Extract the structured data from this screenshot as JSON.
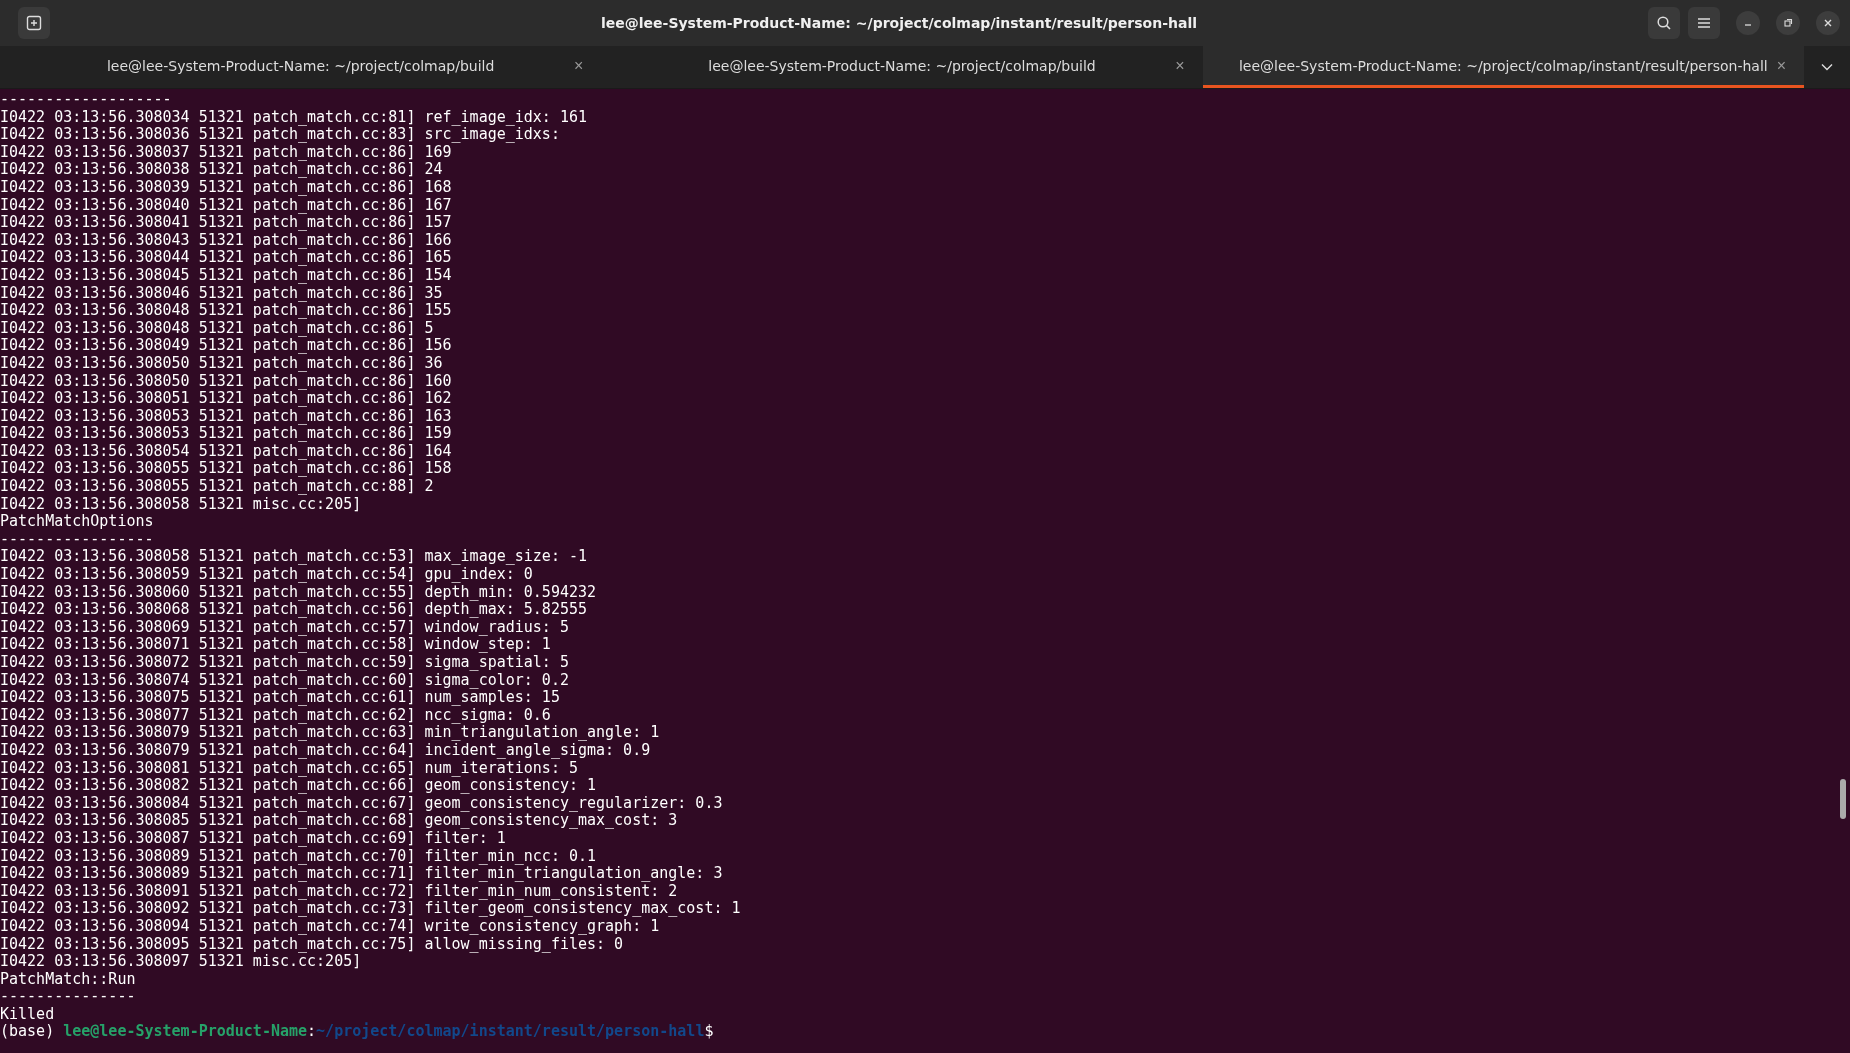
{
  "window": {
    "title": "lee@lee-System-Product-Name: ~/project/colmap/instant/result/person-hall"
  },
  "tabs": [
    {
      "label": "lee@lee-System-Product-Name: ~/project/colmap/build",
      "close": "×",
      "selected": false
    },
    {
      "label": "lee@lee-System-Product-Name: ~/project/colmap/build",
      "close": "×",
      "selected": false
    },
    {
      "label": "lee@lee-System-Product-Name: ~/project/colmap/instant/result/person-hall",
      "close": "×",
      "selected": true
    }
  ],
  "terminal": {
    "lines": [
      "-------------------",
      "I0422 03:13:56.308034 51321 patch_match.cc:81] ref_image_idx: 161",
      "I0422 03:13:56.308036 51321 patch_match.cc:83] src_image_idxs:",
      "I0422 03:13:56.308037 51321 patch_match.cc:86] 169",
      "I0422 03:13:56.308038 51321 patch_match.cc:86] 24",
      "I0422 03:13:56.308039 51321 patch_match.cc:86] 168",
      "I0422 03:13:56.308040 51321 patch_match.cc:86] 167",
      "I0422 03:13:56.308041 51321 patch_match.cc:86] 157",
      "I0422 03:13:56.308043 51321 patch_match.cc:86] 166",
      "I0422 03:13:56.308044 51321 patch_match.cc:86] 165",
      "I0422 03:13:56.308045 51321 patch_match.cc:86] 154",
      "I0422 03:13:56.308046 51321 patch_match.cc:86] 35",
      "I0422 03:13:56.308048 51321 patch_match.cc:86] 155",
      "I0422 03:13:56.308048 51321 patch_match.cc:86] 5",
      "I0422 03:13:56.308049 51321 patch_match.cc:86] 156",
      "I0422 03:13:56.308050 51321 patch_match.cc:86] 36",
      "I0422 03:13:56.308050 51321 patch_match.cc:86] 160",
      "I0422 03:13:56.308051 51321 patch_match.cc:86] 162",
      "I0422 03:13:56.308053 51321 patch_match.cc:86] 163",
      "I0422 03:13:56.308053 51321 patch_match.cc:86] 159",
      "I0422 03:13:56.308054 51321 patch_match.cc:86] 164",
      "I0422 03:13:56.308055 51321 patch_match.cc:86] 158",
      "I0422 03:13:56.308055 51321 patch_match.cc:88] 2",
      "I0422 03:13:56.308058 51321 misc.cc:205]",
      "PatchMatchOptions",
      "-----------------",
      "I0422 03:13:56.308058 51321 patch_match.cc:53] max_image_size: -1",
      "I0422 03:13:56.308059 51321 patch_match.cc:54] gpu_index: 0",
      "I0422 03:13:56.308060 51321 patch_match.cc:55] depth_min: 0.594232",
      "I0422 03:13:56.308068 51321 patch_match.cc:56] depth_max: 5.82555",
      "I0422 03:13:56.308069 51321 patch_match.cc:57] window_radius: 5",
      "I0422 03:13:56.308071 51321 patch_match.cc:58] window_step: 1",
      "I0422 03:13:56.308072 51321 patch_match.cc:59] sigma_spatial: 5",
      "I0422 03:13:56.308074 51321 patch_match.cc:60] sigma_color: 0.2",
      "I0422 03:13:56.308075 51321 patch_match.cc:61] num_samples: 15",
      "I0422 03:13:56.308077 51321 patch_match.cc:62] ncc_sigma: 0.6",
      "I0422 03:13:56.308079 51321 patch_match.cc:63] min_triangulation_angle: 1",
      "I0422 03:13:56.308079 51321 patch_match.cc:64] incident_angle_sigma: 0.9",
      "I0422 03:13:56.308081 51321 patch_match.cc:65] num_iterations: 5",
      "I0422 03:13:56.308082 51321 patch_match.cc:66] geom_consistency: 1",
      "I0422 03:13:56.308084 51321 patch_match.cc:67] geom_consistency_regularizer: 0.3",
      "I0422 03:13:56.308085 51321 patch_match.cc:68] geom_consistency_max_cost: 3",
      "I0422 03:13:56.308087 51321 patch_match.cc:69] filter: 1",
      "I0422 03:13:56.308089 51321 patch_match.cc:70] filter_min_ncc: 0.1",
      "I0422 03:13:56.308089 51321 patch_match.cc:71] filter_min_triangulation_angle: 3",
      "I0422 03:13:56.308091 51321 patch_match.cc:72] filter_min_num_consistent: 2",
      "I0422 03:13:56.308092 51321 patch_match.cc:73] filter_geom_consistency_max_cost: 1",
      "I0422 03:13:56.308094 51321 patch_match.cc:74] write_consistency_graph: 1",
      "I0422 03:13:56.308095 51321 patch_match.cc:75] allow_missing_files: 0",
      "I0422 03:13:56.308097 51321 misc.cc:205]",
      "PatchMatch::Run",
      "---------------",
      "Killed"
    ],
    "prompt": {
      "env": "(base)",
      "user": "lee@lee-System-Product-Name",
      "separator": ":",
      "path": "~/project/colmap/instant/result/person-hall",
      "symbol": "$"
    }
  }
}
